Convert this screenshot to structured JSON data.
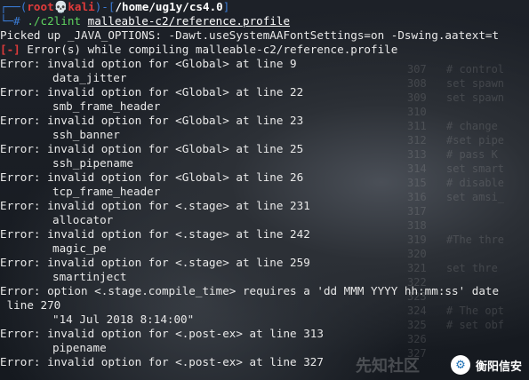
{
  "prompt": {
    "line1_open": "┌──(",
    "user": "root💀kali",
    "line1_mid": ")-[",
    "path": "/home/ug1y/cs4.0",
    "line1_close": "]",
    "line2_prefix": "└─# ",
    "command": "./c2lint",
    "argument": "malleable-c2/reference.profile"
  },
  "output": {
    "picked_up": "Picked up _JAVA_OPTIONS: -Dawt.useSystemAAFontSettings=on -Dswing.aatext=t",
    "error_mark": "[-]",
    "error_summary": " Error(s) while compiling malleable-c2/reference.profile",
    "lines": [
      {
        "text": "Error: invalid option for <Global> at line 9",
        "indented": false
      },
      {
        "text": "data_jitter",
        "indented": true
      },
      {
        "text": "Error: invalid option for <Global> at line 22",
        "indented": false
      },
      {
        "text": "smb_frame_header",
        "indented": true
      },
      {
        "text": "Error: invalid option for <Global> at line 23",
        "indented": false
      },
      {
        "text": "ssh_banner",
        "indented": true
      },
      {
        "text": "Error: invalid option for <Global> at line 25",
        "indented": false
      },
      {
        "text": "ssh_pipename",
        "indented": true
      },
      {
        "text": "Error: invalid option for <Global> at line 26",
        "indented": false
      },
      {
        "text": "tcp_frame_header",
        "indented": true
      },
      {
        "text": "Error: invalid option for <.stage> at line 231",
        "indented": false
      },
      {
        "text": "allocator",
        "indented": true
      },
      {
        "text": "Error: invalid option for <.stage> at line 242",
        "indented": false
      },
      {
        "text": "magic_pe",
        "indented": true
      },
      {
        "text": "Error: invalid option for <.stage> at line 259",
        "indented": false
      },
      {
        "text": "smartinject",
        "indented": true
      },
      {
        "text": "Error: option <.stage.compile_time> requires a 'dd MMM YYYY hh:mm:ss' date",
        "indented": false
      },
      {
        "text": " line 270",
        "indented": false
      },
      {
        "text": "\"14 Jul 2018 8:14:00\"",
        "indented": true
      },
      {
        "text": "Error: invalid option for <.post-ex> at line 313",
        "indented": false
      },
      {
        "text": "pipename",
        "indented": true
      },
      {
        "text": "Error: invalid option for <.post-ex> at line 327",
        "indented": false
      }
    ]
  },
  "background_lines": [
    {
      "num": "307",
      "text": "# control"
    },
    {
      "num": "308",
      "text": "set spawn"
    },
    {
      "num": "309",
      "text": "set spawn"
    },
    {
      "num": "310",
      "text": ""
    },
    {
      "num": "311",
      "text": "# change"
    },
    {
      "num": "312",
      "text": "#set pipe"
    },
    {
      "num": "313",
      "text": "# pass K"
    },
    {
      "num": "314",
      "text": "set smart"
    },
    {
      "num": "315",
      "text": "# disable"
    },
    {
      "num": "316",
      "text": "set amsi_"
    },
    {
      "num": "317",
      "text": ""
    },
    {
      "num": "318",
      "text": ""
    },
    {
      "num": "319",
      "text": "#The thre"
    },
    {
      "num": "320",
      "text": ""
    },
    {
      "num": "321",
      "text": "set thre"
    },
    {
      "num": "322",
      "text": ""
    },
    {
      "num": "323",
      "text": ""
    },
    {
      "num": "324",
      "text": "# The opt"
    },
    {
      "num": "325",
      "text": "# set obf"
    },
    {
      "num": "326",
      "text": ""
    },
    {
      "num": "327",
      "text": ""
    }
  ],
  "watermark": {
    "left_text": "先知社区",
    "logo_glyph": "⚙",
    "brand": "衡阳信安"
  }
}
